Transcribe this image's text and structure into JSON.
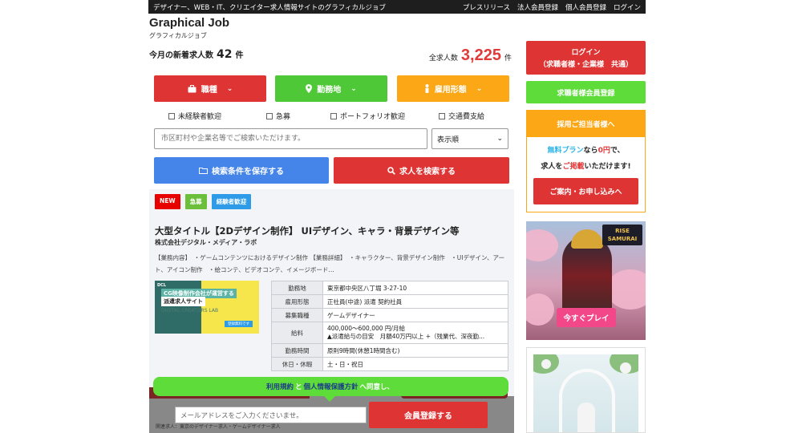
{
  "topbar": {
    "tagline": "デザイナー、WEB・IT、クリエイター求人情報サイトのグラフィカルジョブ",
    "links": [
      "プレスリリース",
      "法人会員登録",
      "個人会員登録",
      "ログイン"
    ]
  },
  "header": {
    "title": "Graphical Job",
    "subtitle": "グラフィカルジョブ",
    "new_jobs_label": "今月の新着求人数",
    "new_jobs_count": "42",
    "new_jobs_unit": "件",
    "total_label": "全求人数",
    "total_count": "3,225",
    "total_unit": "件"
  },
  "filters": {
    "job_type": "職種",
    "location": "勤務地",
    "employment": "雇用形態",
    "checkboxes": [
      "未経験者歓迎",
      "急募",
      "ポートフォリオ歓迎",
      "交通費支給"
    ],
    "search_placeholder": "市区町村や企業名等でご検索いただけます。",
    "sort_value": "表示順",
    "save_label": "検索条件を保存する",
    "search_label": "求人を検索する"
  },
  "job": {
    "badges": [
      "NEW",
      "急募",
      "経験者歓迎"
    ],
    "title": "大型タイトル【2Dデザイン制作】 UIデザイン、キャラ・背景デザイン等",
    "company": "株式会社デジタル・メディア・ラボ",
    "desc_line1": "【業務内容】　・ゲームコンテンツにおけるデザイン制作 【業務詳細】　・キャラクター、背景デザイン制作　・UIデザイン、アー",
    "desc_line2": "ト、アイコン制作　・絵コンテ、ビデオコンテ、イメージボード…",
    "thumb_line1": "CG映像制作会社が運営する",
    "thumb_line2": "派遣求人サイト",
    "thumb_line3": "DIGITAL CREATORS LAB",
    "thumb_logo": "DCL",
    "thumb_tag": "登録無料です",
    "details": [
      {
        "key": "勤務地",
        "value": "東京都中央区八丁堀 3-27-10"
      },
      {
        "key": "雇用形態",
        "value": "正社員(中途) 派遣 契約社員"
      },
      {
        "key": "募集職種",
        "value": "ゲームデザイナー"
      },
      {
        "key": "給料",
        "value": "400,000〜600,000 円/月給",
        "value2": "▲派遣給与の目安　月額40万円以上 +（残業代、深夜勤..."
      },
      {
        "key": "勤務時間",
        "value": "原則9時間(休憩1時間含む)"
      },
      {
        "key": "休日・休暇",
        "value": "土・日・祝日"
      }
    ]
  },
  "consent": {
    "terms": "利用規約",
    "and": "と",
    "privacy": "個人情報保護方針",
    "suffix": "へ同意し、",
    "email_placeholder": "メールアドレスをご入力くださいませ。",
    "register": "会員登録する",
    "footer_note": "関連求人：東京のデザイナー求人・ゲームデザイナー求人"
  },
  "sidebar": {
    "login_line1": "ログイン",
    "login_line2": "（求職者様・企業様　共通）",
    "register": "求職者様会員登録",
    "recruit_head": "採用ご担当者様へ",
    "free_plan": "無料プラン",
    "nara": "なら",
    "zero_yen": "0円",
    "de": "で、",
    "recruit_prefix": "求人を",
    "recruit_highlight": "ご掲載",
    "recruit_suffix": "いただけます!",
    "recruit_button": "ご案内・お申し込みへ",
    "game_logo_line1": "RISE",
    "game_logo_line2": "SAMURAI",
    "game_play": "今すぐプレイ"
  }
}
